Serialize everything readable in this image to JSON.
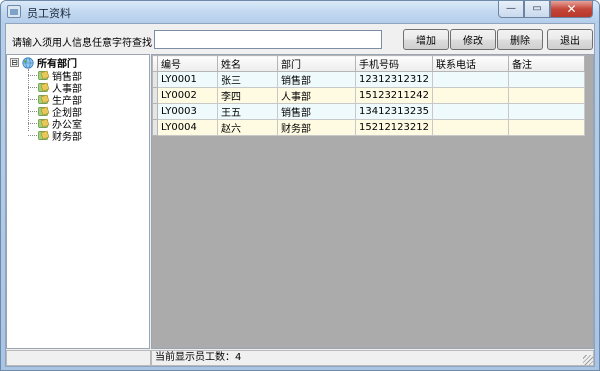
{
  "window": {
    "title": "员工资料",
    "controls": {
      "minimize": "—",
      "maximize": "▭",
      "close": "✕"
    }
  },
  "toolbar": {
    "search_label": "请输入须用人信息任意字符查找",
    "search_value": "",
    "buttons": {
      "add": "增加",
      "edit": "修改",
      "delete": "删除",
      "exit": "退出"
    }
  },
  "tree": {
    "root": {
      "expander": "⊟",
      "label": "所有部门",
      "icon": "globe-icon"
    },
    "items": [
      {
        "label": "销售部",
        "icon": "department-icon"
      },
      {
        "label": "人事部",
        "icon": "department-icon"
      },
      {
        "label": "生产部",
        "icon": "department-icon"
      },
      {
        "label": "企划部",
        "icon": "department-icon"
      },
      {
        "label": "办公室",
        "icon": "department-icon"
      },
      {
        "label": "财务部",
        "icon": "department-icon"
      }
    ]
  },
  "grid": {
    "columns": [
      "编号",
      "姓名",
      "部门",
      "手机号码",
      "联系电话",
      "备注"
    ],
    "rows": [
      [
        "LY0001",
        "张三",
        "销售部",
        "12312312312",
        "",
        ""
      ],
      [
        "LY0002",
        "李四",
        "人事部",
        "15123211242",
        "",
        ""
      ],
      [
        "LY0003",
        "王五",
        "销售部",
        "13412313235",
        "",
        ""
      ],
      [
        "LY0004",
        "赵六",
        "财务部",
        "15212123212",
        "",
        ""
      ]
    ]
  },
  "status": {
    "left": "",
    "count_text": "当前显示员工数：4"
  },
  "colors": {
    "row_odd": "#eefafb",
    "row_even": "#fffbe3",
    "grid_background": "#ababab"
  }
}
